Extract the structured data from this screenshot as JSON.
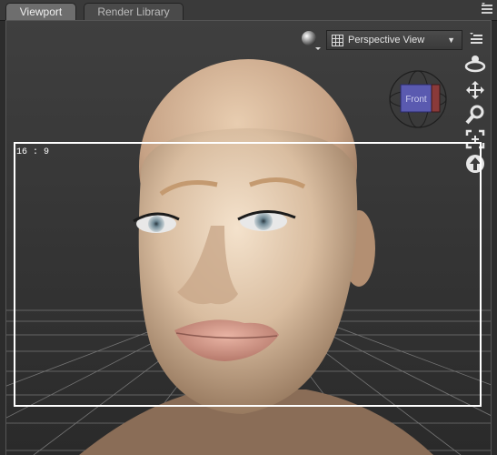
{
  "tabs": [
    {
      "label": "Viewport",
      "active": true
    },
    {
      "label": "Render Library",
      "active": false
    }
  ],
  "viewport": {
    "camera_label": "Perspective View",
    "aspect_ratio_label": "16 : 9",
    "cube_face_label": "Front"
  },
  "icons": {
    "tab_menu": "panel-menu-icon",
    "sphere": "render-preview-sphere-icon",
    "grid": "grid-icon",
    "dropdown": "chevron-down-icon",
    "viewport_menu": "viewport-menu-icon",
    "orbit": "orbit-icon",
    "pan": "pan-move-icon",
    "zoom": "zoom-magnifier-icon",
    "frame": "frame-selection-icon",
    "up": "up-arrow-icon"
  },
  "colors": {
    "accent_cube": "#5a5ab0",
    "frame": "#ffffff"
  }
}
